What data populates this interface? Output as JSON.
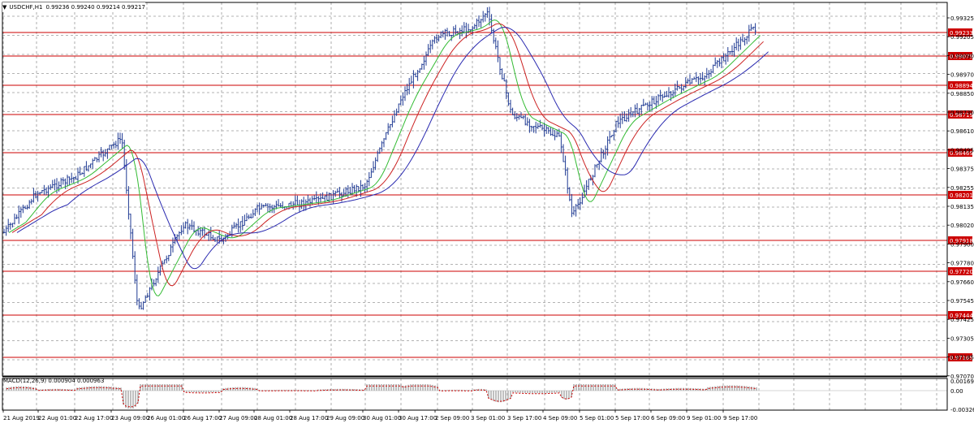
{
  "header": {
    "symbol": "USDCHF,H1",
    "ohlc": "0.99236 0.99240 0.99214 0.99217",
    "menu_icon": "triangle-down-icon"
  },
  "price_axis": {
    "ticks": [
      "0.99325",
      "0.99205",
      "0.99090",
      "0.98970",
      "0.98850",
      "0.98730",
      "0.98610",
      "0.98495",
      "0.98375",
      "0.98255",
      "0.98135",
      "0.98020",
      "0.97900",
      "0.97780",
      "0.97660",
      "0.97545",
      "0.97425",
      "0.97305",
      "0.97185",
      "0.97070"
    ],
    "current_price": "0.99233"
  },
  "levels": [
    "0.99079",
    "0.98894",
    "0.98719",
    "0.98469",
    "0.98201",
    "0.97918",
    "0.97720",
    "0.97444",
    "0.97169"
  ],
  "macd": {
    "label": "MACD(12,26,9) 0.000904 0.000963",
    "ticks": [
      "0.001693",
      "0.00",
      "-0.003269"
    ]
  },
  "time_axis": {
    "labels": [
      "21 Aug 2019",
      "22 Aug 01:00",
      "22 Aug 17:00",
      "23 Aug 09:00",
      "26 Aug 01:00",
      "26 Aug 17:00",
      "27 Aug 09:00",
      "28 Aug 01:00",
      "28 Aug 17:00",
      "29 Aug 09:00",
      "30 Aug 01:00",
      "30 Aug 17:00",
      "2 Sep 09:00",
      "3 Sep 01:00",
      "3 Sep 17:00",
      "4 Sep 09:00",
      "5 Sep 01:00",
      "5 Sep 17:00",
      "6 Sep 09:00",
      "9 Sep 01:00",
      "9 Sep 17:00"
    ]
  },
  "colors": {
    "bull": "#1f3a93",
    "bear": "#1f3a93",
    "level": "#cc0000",
    "ma_fast": "#33bb33",
    "ma_mid": "#cc2222",
    "ma_slow": "#2a2ab0",
    "grid": "#9a9a9a",
    "macd_signal": "#cc0000",
    "macd_hist": "#b0b0b0"
  },
  "chart_data": {
    "type": "line",
    "title": "USDCHF,H1",
    "ylim": [
      0.9704,
      0.9941
    ],
    "x": [
      "21 Aug 2019",
      "22 Aug 01:00",
      "22 Aug 17:00",
      "23 Aug 09:00",
      "26 Aug 01:00",
      "26 Aug 17:00",
      "27 Aug 09:00",
      "28 Aug 01:00",
      "28 Aug 17:00",
      "29 Aug 09:00",
      "30 Aug 01:00",
      "30 Aug 17:00",
      "2 Sep 09:00",
      "3 Sep 01:00",
      "3 Sep 17:00",
      "4 Sep 09:00",
      "5 Sep 01:00",
      "5 Sep 17:00",
      "6 Sep 09:00",
      "9 Sep 01:00",
      "9 Sep 17:00"
    ],
    "series": [
      {
        "values": [
          0.9795,
          0.982,
          0.983,
          0.9855,
          0.9745,
          0.98,
          0.979,
          0.981,
          0.9815,
          0.9825,
          0.988,
          0.992,
          0.9925,
          0.9935,
          0.987,
          0.9855,
          0.9805,
          0.9865,
          0.988,
          0.9895,
          0.9925
        ]
      }
    ]
  }
}
